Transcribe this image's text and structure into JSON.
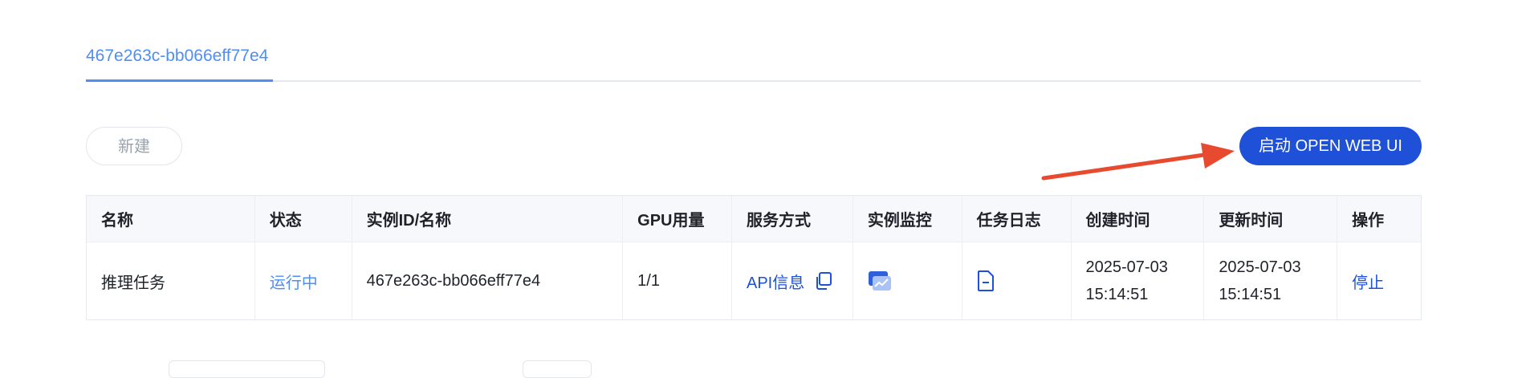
{
  "tabs": [
    {
      "label": "467e263c-bb066eff77e4"
    }
  ],
  "toolbar": {
    "new_label": "新建",
    "open_webui_label": "启动 OPEN WEB UI"
  },
  "table": {
    "headers": [
      "名称",
      "状态",
      "实例ID/名称",
      "GPU用量",
      "服务方式",
      "实例监控",
      "任务日志",
      "创建时间",
      "更新时间",
      "操作"
    ],
    "rows": [
      {
        "name": "推理任务",
        "status": "运行中",
        "instance_id": "467e263c-bb066eff77e4",
        "gpu": "1/1",
        "service": "API信息",
        "created_date": "2025-07-03",
        "created_time": "15:14:51",
        "updated_date": "2025-07-03",
        "updated_time": "15:14:51",
        "action": "停止"
      }
    ]
  },
  "colors": {
    "accent": "#1e50d8",
    "tab_active": "#4d8ef7",
    "arrow": "#e84a2f"
  },
  "icons": {
    "copy": "copy-icon",
    "monitor": "monitor-chart-icon",
    "log": "document-icon",
    "arrow": "annotation-arrow"
  }
}
